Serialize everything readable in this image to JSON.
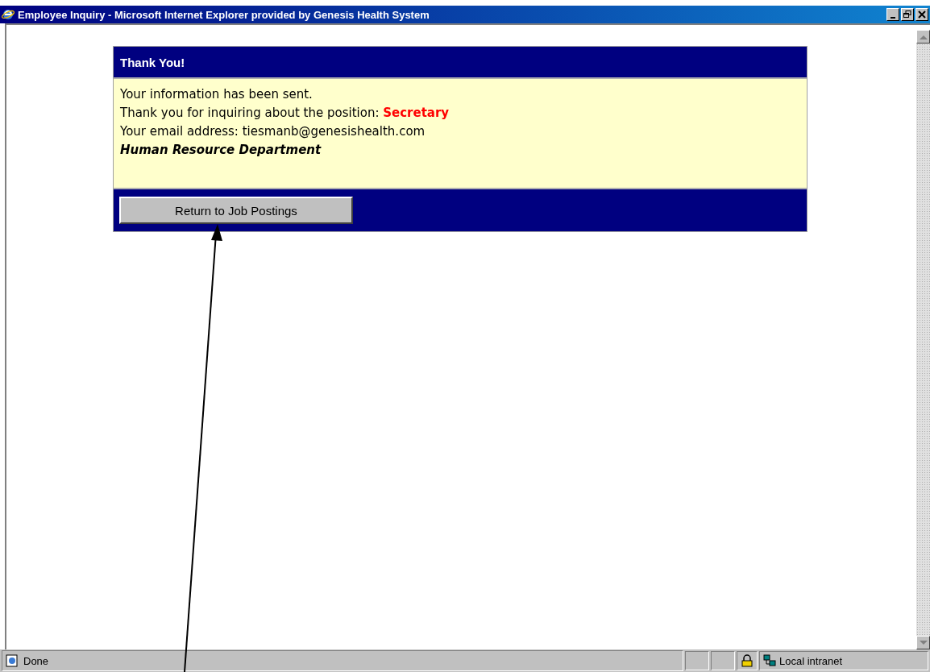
{
  "window": {
    "title": "Employee Inquiry - Microsoft Internet Explorer provided by Genesis Health System"
  },
  "card": {
    "title": "Thank You!",
    "lines": [
      {
        "kind": "plain",
        "text": "Your information has been sent."
      },
      {
        "kind": "position",
        "text": "Thank you for inquiring about the position:",
        "value": "Secretary"
      },
      {
        "kind": "plain",
        "text": "Your email address: tiesmanb@genesishealth.com"
      },
      {
        "kind": "signature",
        "text": "Human Resource Department"
      }
    ],
    "button": "Return to Job Postings"
  },
  "status_bar": {
    "text": "Done",
    "zone": "Local intranet"
  }
}
